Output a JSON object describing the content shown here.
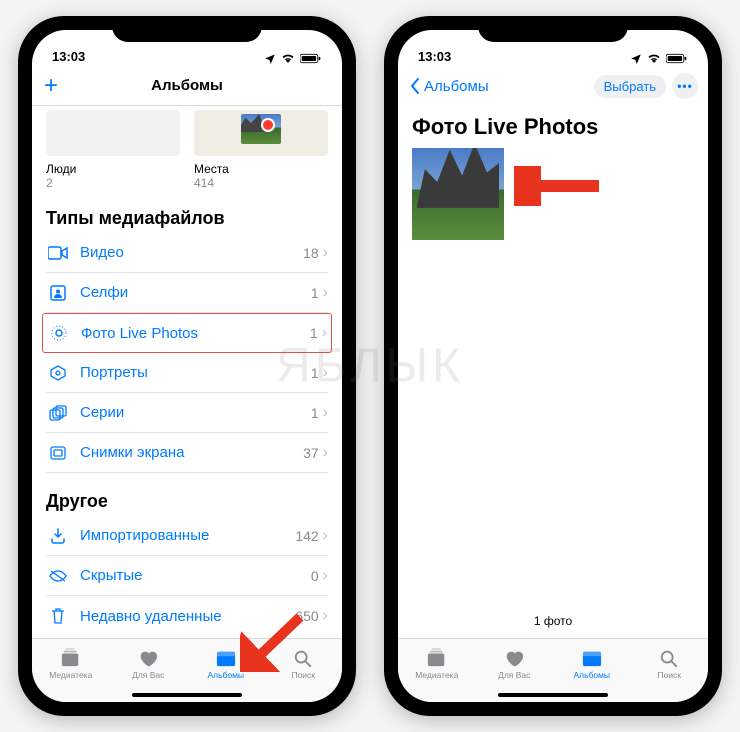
{
  "status": {
    "time": "13:03"
  },
  "screenA": {
    "nav_title": "Альбомы",
    "add_icon": "+",
    "albums": [
      {
        "label": "Люди",
        "count": "2"
      },
      {
        "label": "Места",
        "count": "414"
      }
    ],
    "section1_title": "Типы медиафайлов",
    "media_types": [
      {
        "icon": "video",
        "label": "Видео",
        "count": "18"
      },
      {
        "icon": "selfie",
        "label": "Селфи",
        "count": "1"
      },
      {
        "icon": "live",
        "label": "Фото Live Photos",
        "count": "1",
        "highlight": true
      },
      {
        "icon": "portrait",
        "label": "Портреты",
        "count": "1"
      },
      {
        "icon": "burst",
        "label": "Серии",
        "count": "1"
      },
      {
        "icon": "screenshot",
        "label": "Снимки экрана",
        "count": "37"
      }
    ],
    "section2_title": "Другое",
    "other": [
      {
        "icon": "import",
        "label": "Импортированные",
        "count": "142"
      },
      {
        "icon": "hidden",
        "label": "Скрытые",
        "count": "0"
      },
      {
        "icon": "trash",
        "label": "Недавно удаленные",
        "count": "650"
      }
    ]
  },
  "screenB": {
    "back_label": "Альбомы",
    "select_label": "Выбрать",
    "title": "Фото Live Photos",
    "footer": "1 фото"
  },
  "tabs": {
    "library": "Медиатека",
    "for_you": "Для Вас",
    "albums": "Альбомы",
    "search": "Поиск"
  },
  "watermark": "ЯБЛЫК",
  "colors": {
    "accent": "#007aff",
    "highlight": "#d9534f"
  }
}
